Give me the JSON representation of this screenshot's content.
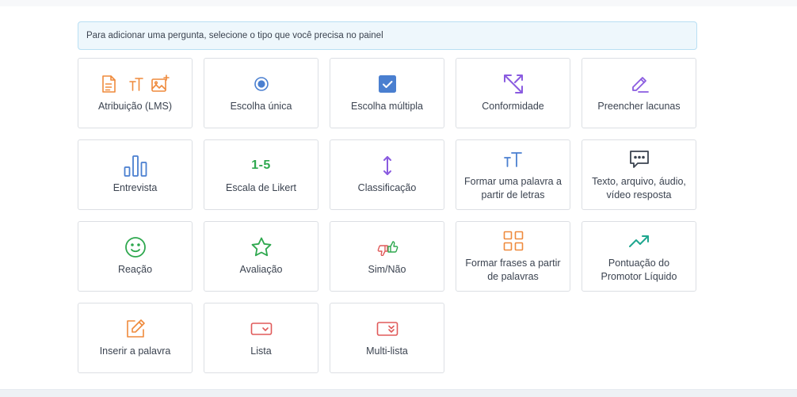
{
  "hint": {
    "text": "Para adicionar uma pergunta, selecione o tipo que você precisa no painel"
  },
  "tiles": [
    {
      "label": "Atribuição (LMS)",
      "icon": "assignment-icons"
    },
    {
      "label": "Escolha única",
      "icon": "radio-icon"
    },
    {
      "label": "Escolha múltipla",
      "icon": "checkbox-icon"
    },
    {
      "label": "Conformidade",
      "icon": "arrows-diagonal-icon"
    },
    {
      "label": "Preencher lacunas",
      "icon": "pencil-icon"
    },
    {
      "label": "Entrevista",
      "icon": "bar-chart-icon"
    },
    {
      "label": "Escala de Likert",
      "icon": "likert-scale-icon",
      "icon_text": "1-5"
    },
    {
      "label": "Classificação",
      "icon": "vertical-arrows-icon"
    },
    {
      "label": "Formar uma palavra a partir de letras",
      "icon": "text-size-icon"
    },
    {
      "label": "Texto, arquivo, áudio, vídeo resposta",
      "icon": "comment-icon"
    },
    {
      "label": "Reação",
      "icon": "smiley-icon"
    },
    {
      "label": "Avaliação",
      "icon": "star-icon"
    },
    {
      "label": "Sim/Não",
      "icon": "thumbs-icon"
    },
    {
      "label": "Formar frases a partir de palavras",
      "icon": "grid-icon"
    },
    {
      "label": "Pontuação do Promotor Líquido",
      "icon": "trend-icon"
    },
    {
      "label": "Inserir a palavra",
      "icon": "edit-box-icon"
    },
    {
      "label": "Lista",
      "icon": "dropdown-icon"
    },
    {
      "label": "Multi-lista",
      "icon": "multi-dropdown-icon"
    }
  ],
  "colors": {
    "orange": "#ef8a3c",
    "blue": "#4a7fd0",
    "purple": "#8a5be0",
    "green": "#2fa84f",
    "teal": "#1fa78f",
    "red": "#e05a5a",
    "dark": "#3b4350"
  }
}
